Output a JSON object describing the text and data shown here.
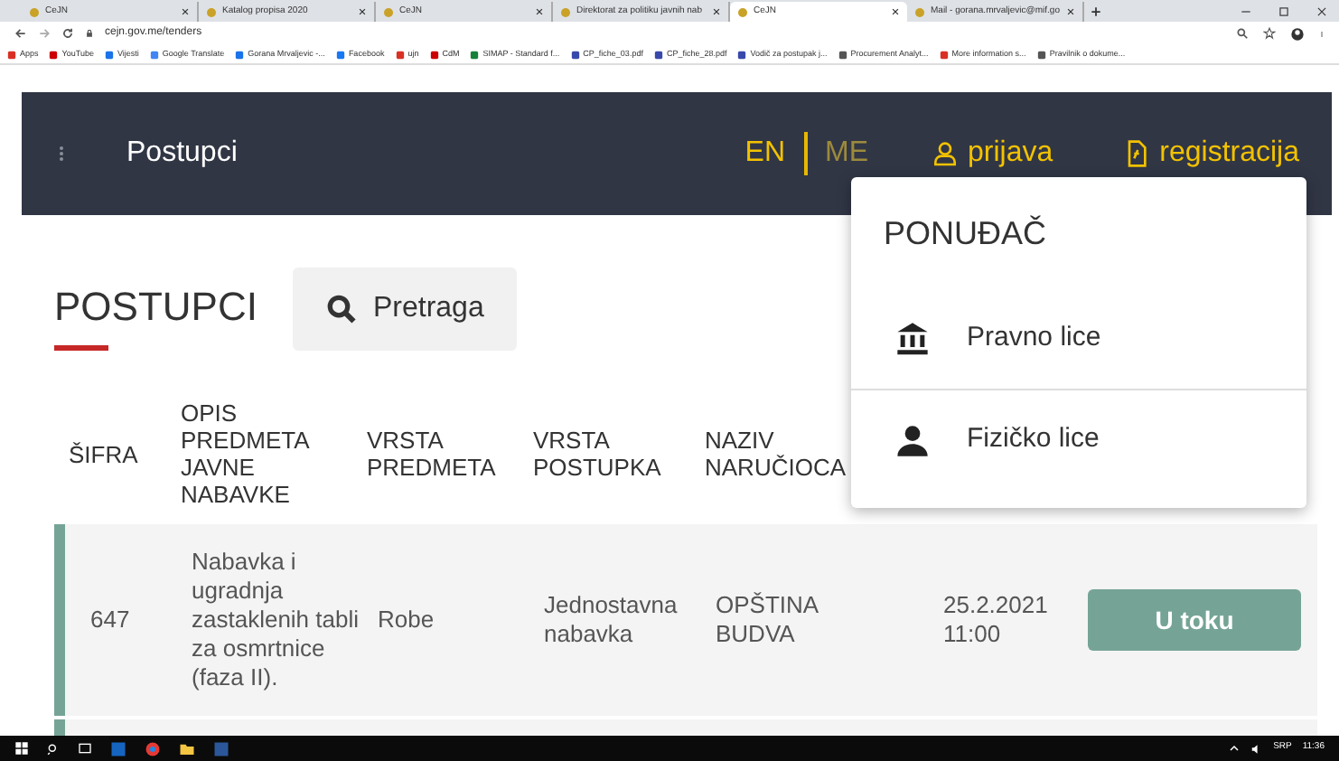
{
  "browser": {
    "tabs": [
      {
        "title": "CeJN",
        "selected": false
      },
      {
        "title": "Katalog propisa 2020",
        "selected": false
      },
      {
        "title": "CeJN",
        "selected": false
      },
      {
        "title": "Direktorat za politiku javnih nab",
        "selected": false
      },
      {
        "title": "CeJN",
        "selected": true
      },
      {
        "title": "Mail - gorana.mrvaljevic@mif.go",
        "selected": false
      }
    ],
    "address": "cejn.gov.me/tenders",
    "bookmarks": [
      "Apps",
      "YouTube",
      "Vijesti",
      "Google Translate",
      "Gorana Mrvaljevic -...",
      "Facebook",
      "ujn",
      "CdM",
      "SIMAP - Standard f...",
      "CP_fiche_03.pdf",
      "CP_fiche_28.pdf",
      "Vodič za postupak j...",
      "Procurement Analyt...",
      "More information s...",
      "Pravilnik o dokume..."
    ]
  },
  "header": {
    "title": "Postupci",
    "languages": [
      {
        "label": "EN",
        "selected": true
      },
      {
        "label": "ME",
        "selected": false
      }
    ],
    "login": "prijava",
    "register": "registracija"
  },
  "dropdown": {
    "heading": "PONUĐAČ",
    "items": [
      {
        "label": "Pravno lice",
        "kind": "bank"
      },
      {
        "label": "Fizičko lice",
        "kind": "person"
      }
    ]
  },
  "page": {
    "heading": "POSTUPCI",
    "search_button": "Pretraga"
  },
  "table": {
    "columns": [
      "ŠIFRA",
      "OPIS PREDMETA JAVNE NABAVKE",
      "VRSTA PREDMETA",
      "VRSTA POSTUPKA",
      "NAZIV NARUČIOCA"
    ],
    "rows": [
      {
        "cells": [
          "647",
          "Nabavka i ugradnja zastaklenih tabli za osmrtnice (faza II).",
          "Robe",
          "Jednostavna nabavka",
          "OPŠTINA BUDVA",
          "25.2.2021 11:00"
        ],
        "status": "U toku"
      }
    ]
  },
  "taskbar": {
    "language": "SRP",
    "clock": "11:36"
  }
}
